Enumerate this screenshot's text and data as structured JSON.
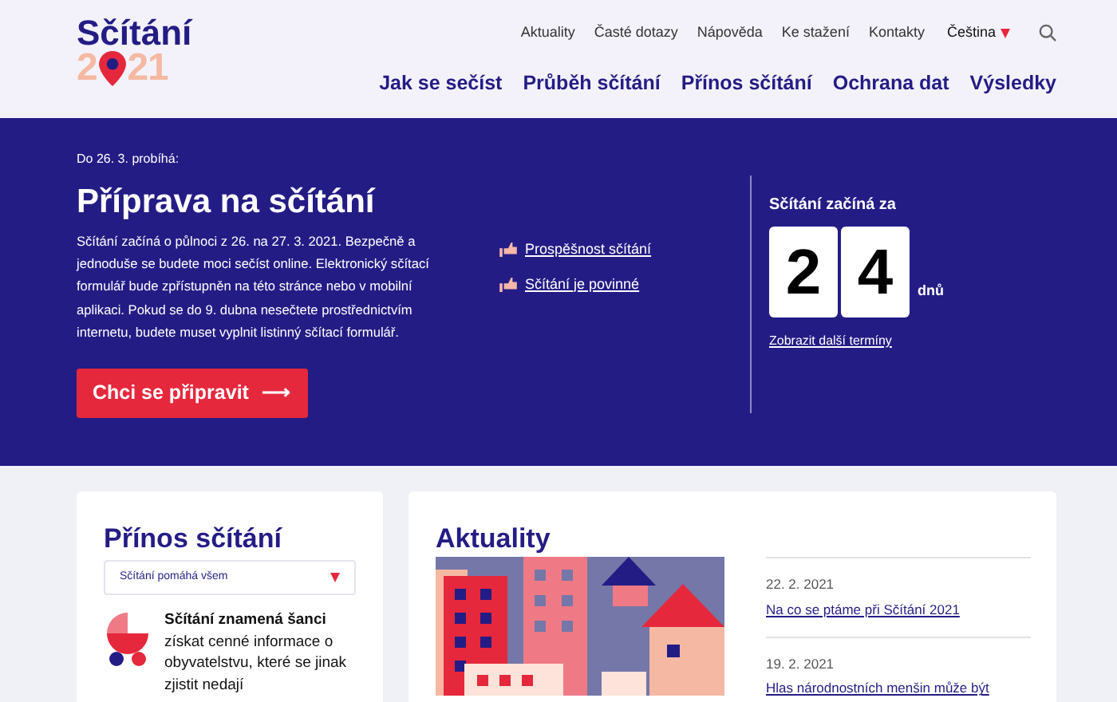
{
  "logo": {
    "title": "Sčítání",
    "year_before": "2",
    "year_after": "21"
  },
  "top_links": [
    "Aktuality",
    "Časté dotazy",
    "Nápověda",
    "Ke stažení",
    "Kontakty"
  ],
  "language": {
    "label": "Čeština"
  },
  "main_nav": [
    "Jak se sečíst",
    "Průběh sčítání",
    "Přínos sčítání",
    "Ochrana dat",
    "Výsledky"
  ],
  "hero": {
    "kicker": "Do 26. 3. probíhá:",
    "title": "Příprava na sčítání",
    "text": "Sčítání začíná o půlnoci z 26. na 27. 3. 2021. Bezpečně a jednoduše se budete moci sečíst online. Elektronický sčítací formulář bude zpřístupněn na této stránce nebo v mobilní aplikaci. Pokud se do 9. dubna nesečtete prostřednictvím internetu, budete muset vyplnit listinný sčítací formulář.",
    "button": "Chci se připravit",
    "arrow": "⟶",
    "links": [
      "Prospěšnost sčítání",
      "Sčítání je povinné"
    ]
  },
  "countdown": {
    "title": "Sčítání začíná za",
    "digits": [
      "2",
      "4"
    ],
    "unit": "dnů",
    "link": "Zobrazit další termíny"
  },
  "benefits": {
    "title": "Přínos sčítání",
    "select": "Sčítání pomáhá všem",
    "lead": "Sčítání znamená šanci",
    "text": "získat cenné informace o obyvatelstvu, které se jinak zjistit nedají"
  },
  "news": {
    "title": "Aktuality",
    "items": [
      {
        "date": "22. 2. 2021",
        "title": "Na co se ptáme při Sčítání 2021"
      },
      {
        "date": "19. 2. 2021",
        "title": "Hlas národnostních menšin může být"
      }
    ]
  }
}
